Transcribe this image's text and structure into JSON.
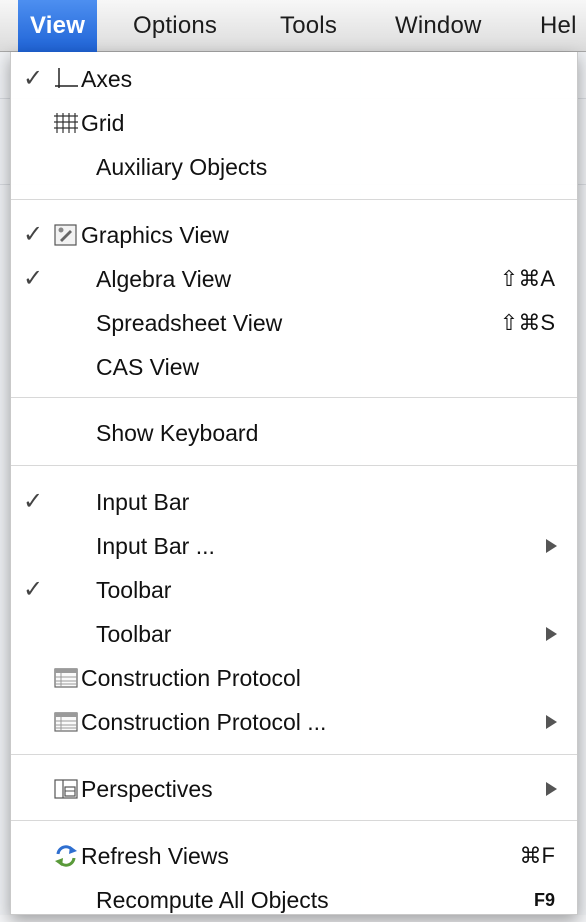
{
  "menubar": {
    "items": [
      "View",
      "Options",
      "Tools",
      "Window",
      "Hel"
    ],
    "active_index": 0
  },
  "menu": {
    "items": [
      {
        "label": "Axes",
        "checked": true,
        "icon": "axes-icon"
      },
      {
        "label": "Grid",
        "checked": false,
        "icon": "grid-icon"
      },
      {
        "label": "Auxiliary Objects",
        "checked": false
      },
      {
        "label": "Graphics View",
        "checked": true,
        "icon": "graphics-view-icon"
      },
      {
        "label": "Algebra View",
        "checked": true,
        "shortcut": "⇧⌘A"
      },
      {
        "label": "Spreadsheet View",
        "checked": false,
        "shortcut": "⇧⌘S"
      },
      {
        "label": "CAS View",
        "checked": false
      },
      {
        "label": "Show Keyboard",
        "checked": false
      },
      {
        "label": "Input Bar",
        "checked": true
      },
      {
        "label": "Input Bar ...",
        "checked": false,
        "submenu": true
      },
      {
        "label": "Toolbar",
        "checked": true
      },
      {
        "label": "Toolbar",
        "checked": false,
        "submenu": true
      },
      {
        "label": "Construction Protocol",
        "checked": false,
        "icon": "table-icon"
      },
      {
        "label": "Construction Protocol ...",
        "checked": false,
        "icon": "table-icon",
        "submenu": true
      },
      {
        "label": "Perspectives",
        "checked": false,
        "icon": "perspectives-icon",
        "submenu": true
      },
      {
        "label": "Refresh Views",
        "checked": false,
        "icon": "refresh-icon",
        "shortcut": "⌘F"
      },
      {
        "label": "Recompute All Objects",
        "checked": false,
        "shortcut": "F9"
      }
    ],
    "check_glyph": "✓"
  },
  "colors": {
    "menubar_active": "#2f72e0",
    "menu_bg": "#ffffff",
    "separator": "#d8d8d8"
  }
}
